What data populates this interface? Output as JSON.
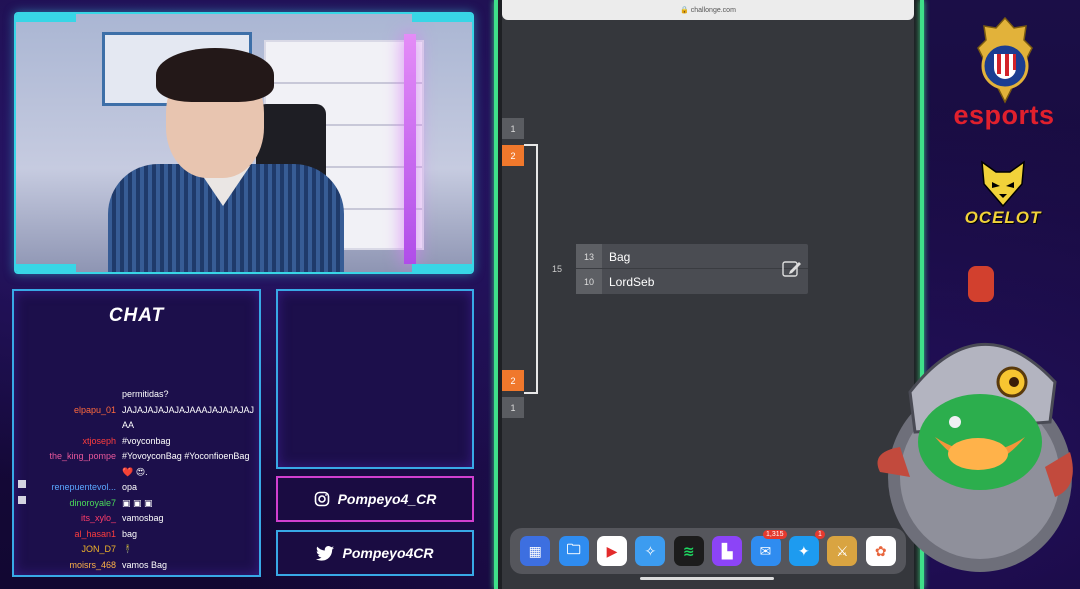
{
  "chat": {
    "title": "CHAT",
    "messages": [
      {
        "user": "",
        "text": "permitidas?",
        "color": "#ffffff"
      },
      {
        "user": "elpapu_01",
        "text": "JAJAJAJAJAJAJAAAJAJAJAJAJAA",
        "color": "#ff6a3d"
      },
      {
        "user": "xtjoseph",
        "text": "#voyconbag",
        "color": "#ff3d3d"
      },
      {
        "user": "the_king_pompe",
        "text": "#YovoyconBag #YoconfioenBag ❤️ 😍.",
        "color": "#e8589b"
      },
      {
        "user": "renepuentevol...",
        "text": "opa",
        "color": "#5aa7ff",
        "badge": true
      },
      {
        "user": "dinoroyale7",
        "text": "▣ ▣ ▣",
        "color": "#4bdc5a",
        "badge": true
      },
      {
        "user": "its_xylo_",
        "text": "vamosbag",
        "color": "#ff3d6a"
      },
      {
        "user": "al_hasan1",
        "text": "bag",
        "color": "#ff3d3d"
      },
      {
        "user": "JON_D7",
        "text": "🕴",
        "color": "#f0b429"
      },
      {
        "user": "moisrs_468",
        "text": "vamos Bag",
        "color": "#ffb347"
      }
    ]
  },
  "socials": {
    "instagram": "Pompeyo4_CR",
    "twitter": "Pompeyo4CR"
  },
  "browser": {
    "url": "challonge.com"
  },
  "bracket": {
    "seeds_top": [
      "1",
      "2"
    ],
    "seeds_bottom": [
      "2",
      "1"
    ],
    "round_label": "15",
    "match": {
      "player1": {
        "seed": "13",
        "name": "Bag"
      },
      "player2": {
        "seed": "10",
        "name": "LordSeb"
      }
    }
  },
  "dock": {
    "apps": [
      {
        "name": "games-folder-icon",
        "color": "#3d6fe0"
      },
      {
        "name": "files-icon",
        "color": "#2f8cf0"
      },
      {
        "name": "youtube-icon",
        "color": "#ffffff"
      },
      {
        "name": "safari-icon",
        "color": "#3c9cf0"
      },
      {
        "name": "spotify-icon",
        "color": "#1c1c1c"
      },
      {
        "name": "twitch-icon",
        "color": "#8c44f7"
      },
      {
        "name": "mail-icon",
        "color": "#2f8cf0",
        "badge": "1,315"
      },
      {
        "name": "twitter-icon",
        "color": "#1d9bf0",
        "badge": "1"
      },
      {
        "name": "clash-of-clans-icon",
        "color": "#d9a441"
      },
      {
        "name": "photos-icon",
        "color": "#ffffff"
      }
    ]
  },
  "sponsors": {
    "team": "esports",
    "partner": "OCELOT"
  }
}
